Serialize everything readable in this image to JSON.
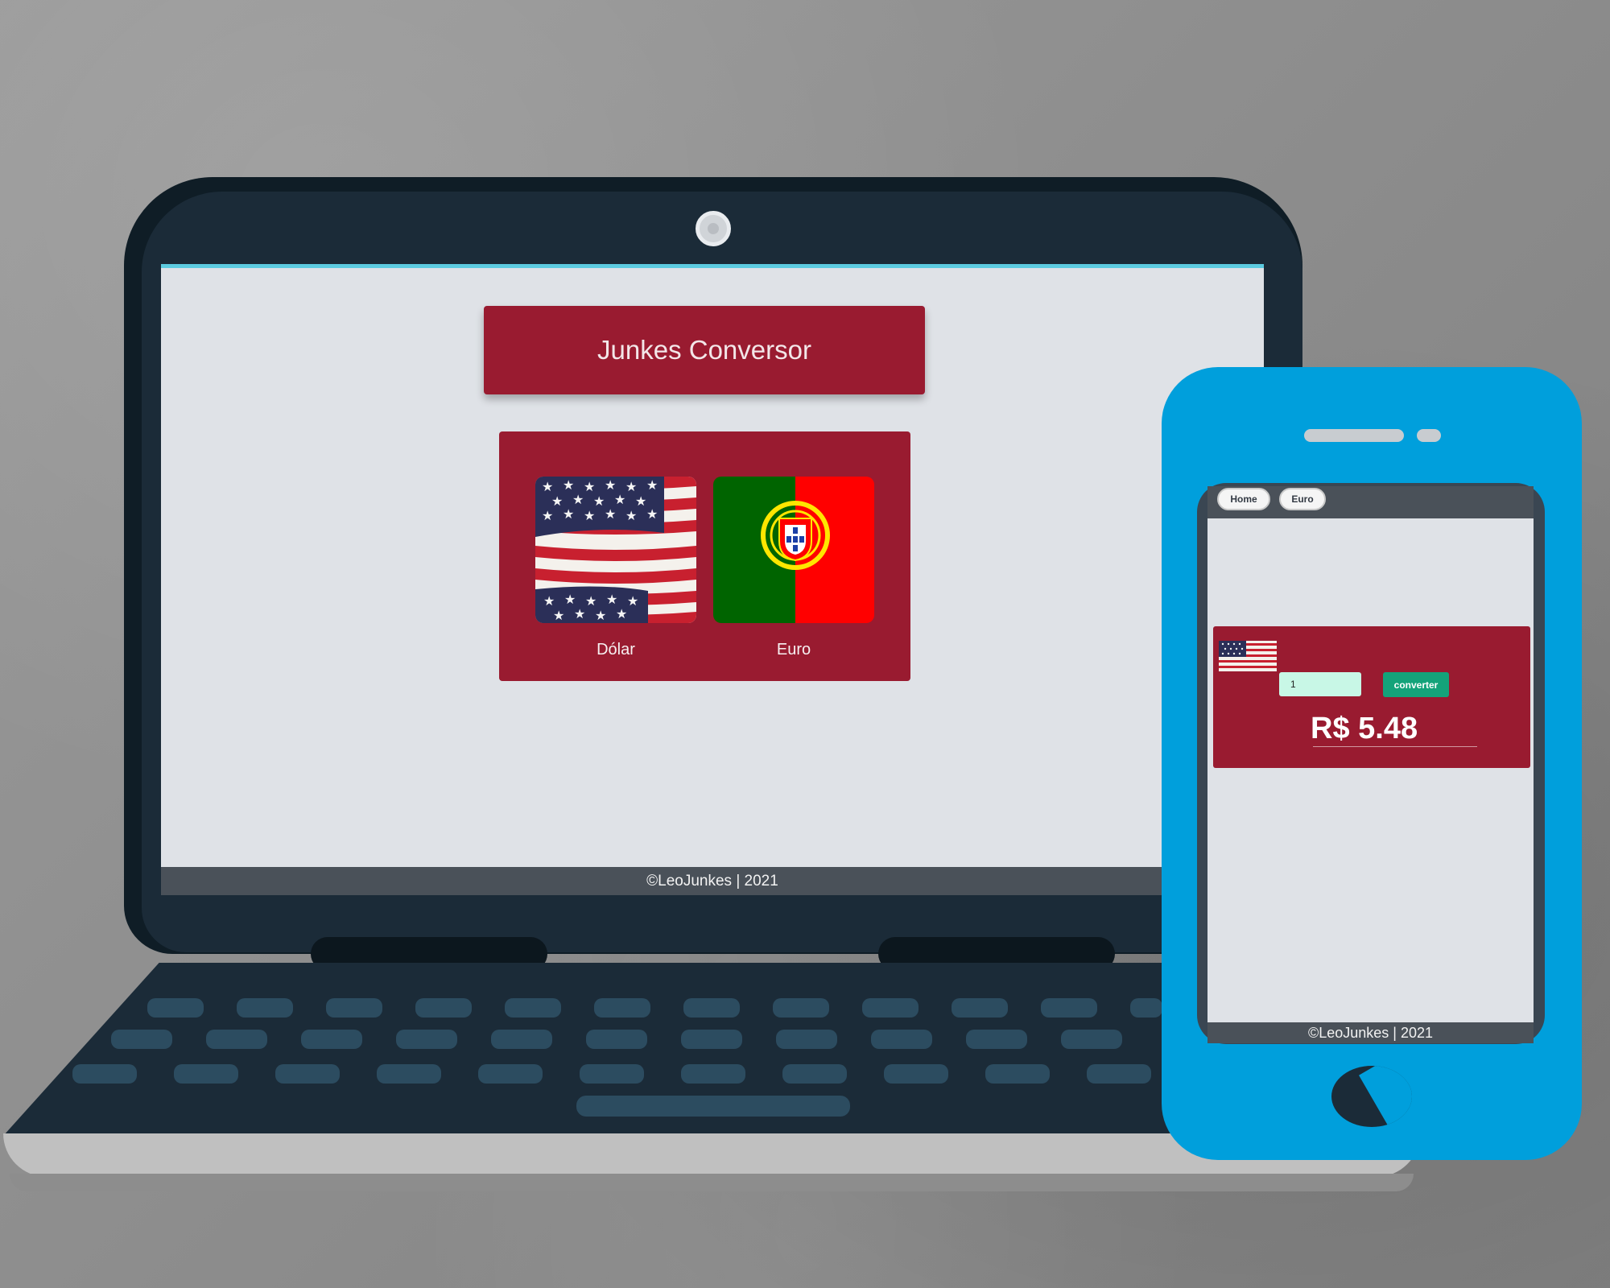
{
  "laptop_app": {
    "title": "Junkes Conversor",
    "currencies": [
      {
        "label": "Dólar",
        "flag_icon": "usa-flag-icon"
      },
      {
        "label": "Euro",
        "flag_icon": "portugal-flag-icon"
      }
    ],
    "footer": "©LeoJunkes | 2021"
  },
  "phone_app": {
    "nav": {
      "home_label": "Home",
      "euro_label": "Euro"
    },
    "amount_value": "1",
    "convert_label": "converter",
    "result": "R$ 5.48",
    "footer": "©LeoJunkes | 2021"
  },
  "colors": {
    "primary": "#991b30",
    "page_bg": "#dfe2e7",
    "footer_bg": "#4a5159",
    "accent_green": "#14a37a",
    "input_bg": "#c8f7e6",
    "phone_body": "#009fdc",
    "laptop_body": "#1b2b38"
  }
}
